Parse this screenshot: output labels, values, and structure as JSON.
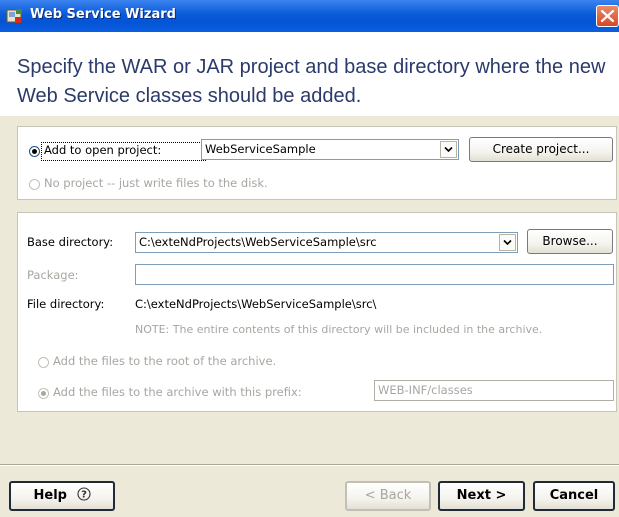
{
  "window": {
    "title": "Web Service Wizard",
    "icon": "wizard-app-icon"
  },
  "heading": "Specify the WAR or JAR project and base directory where the new Web Service classes should be added.",
  "project_panel": {
    "add_to_project": {
      "label": "Add to open project:",
      "selected": true
    },
    "project_combo": {
      "value": "WebServiceSample"
    },
    "create_project_button": "Create project...",
    "no_project": {
      "label": "No project -- just write files to the disk.",
      "selected": false,
      "enabled": false
    }
  },
  "directory_panel": {
    "base_directory_label": "Base directory:",
    "base_directory_value": "C:\\exteNdProjects\\WebServiceSample\\src",
    "browse_button": "Browse...",
    "package_label": "Package:",
    "package_value": "",
    "file_directory_label": "File directory:",
    "file_directory_value": "C:\\exteNdProjects\\WebServiceSample\\src\\",
    "note": "NOTE: The entire contents of this directory will be included in the archive.",
    "root_option": {
      "label": "Add the files to the root of the archive.",
      "selected": false
    },
    "prefix_option": {
      "label": "Add the files to the archive with this prefix:",
      "selected": true
    },
    "prefix_value": "WEB-INF/classes"
  },
  "footer": {
    "help_button": "Help",
    "help_icon": "question-circle-icon",
    "back_button": "< Back",
    "next_button": "Next >",
    "cancel_button": "Cancel"
  },
  "colors": {
    "titlebar": "#0a5bd8",
    "heading_text": "#2b3a6b",
    "dialog_bg": "#ece9d8",
    "close_button": "#d6482a"
  }
}
